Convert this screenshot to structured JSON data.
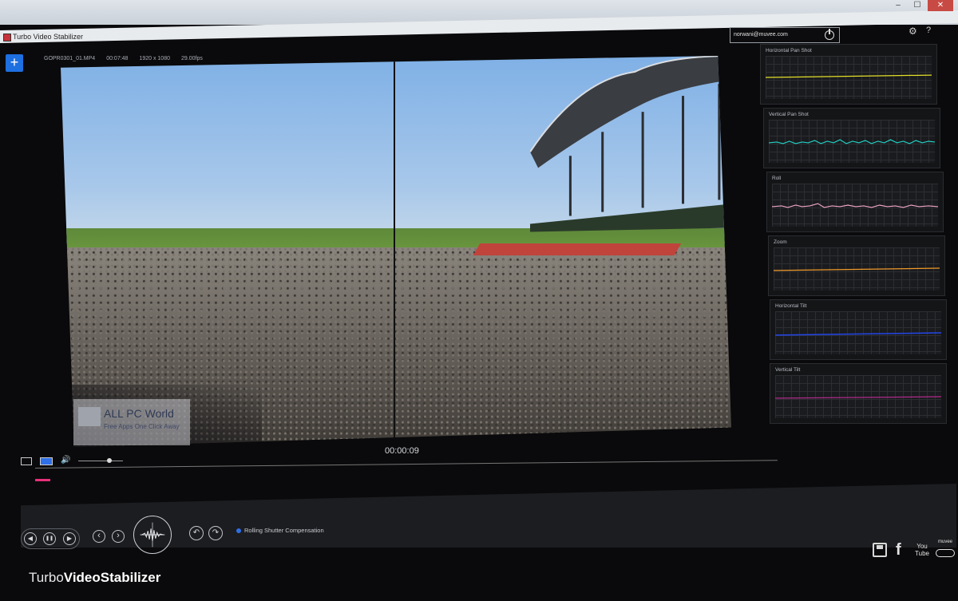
{
  "window": {
    "title": "Turbo Video Stabilizer",
    "controls": [
      "–",
      "☐",
      "✕"
    ]
  },
  "header": {
    "add_label": "+",
    "file_name": "GOPR0301_01.MP4",
    "duration": "00:07:48",
    "resolution": "1920 x 1080",
    "fps": "29.00fps",
    "account_email": "norwani@muvee.com",
    "settings_glyph": "⚙",
    "help_glyph": "?"
  },
  "player": {
    "timecode": "00:00:09",
    "watermark_title": "ALL PC World",
    "watermark_sub": "Free Apps One Click Away",
    "volume_level": 0.7,
    "progress": 0.02
  },
  "graphs": [
    {
      "label": "Horizontal Pan Shot",
      "color": "#e4e02a"
    },
    {
      "label": "Vertical Pan Shot",
      "color": "#22d2c6"
    },
    {
      "label": "Roll",
      "color": "#f0a6c8"
    },
    {
      "label": "Zoom",
      "color": "#f09a2a"
    },
    {
      "label": "Horizontal Tilt",
      "color": "#2446e8"
    },
    {
      "label": "Vertical Tilt",
      "color": "#b02a8c"
    }
  ],
  "controls": {
    "prev_glyph": "◀",
    "pause_glyph": "❚❚",
    "next_glyph": "▶",
    "step_back_glyph": "‹",
    "step_forward_glyph": "›",
    "undo_glyph": "↶",
    "redo_glyph": "↷",
    "rolling_shutter_label": "Rolling Shutter Compensation"
  },
  "share": {
    "facebook_glyph": "f",
    "youtube_label": "You Tube",
    "cloud_label": "muvee"
  },
  "brand": {
    "part1": "Turbo",
    "part2": "VideoStabilizer"
  }
}
